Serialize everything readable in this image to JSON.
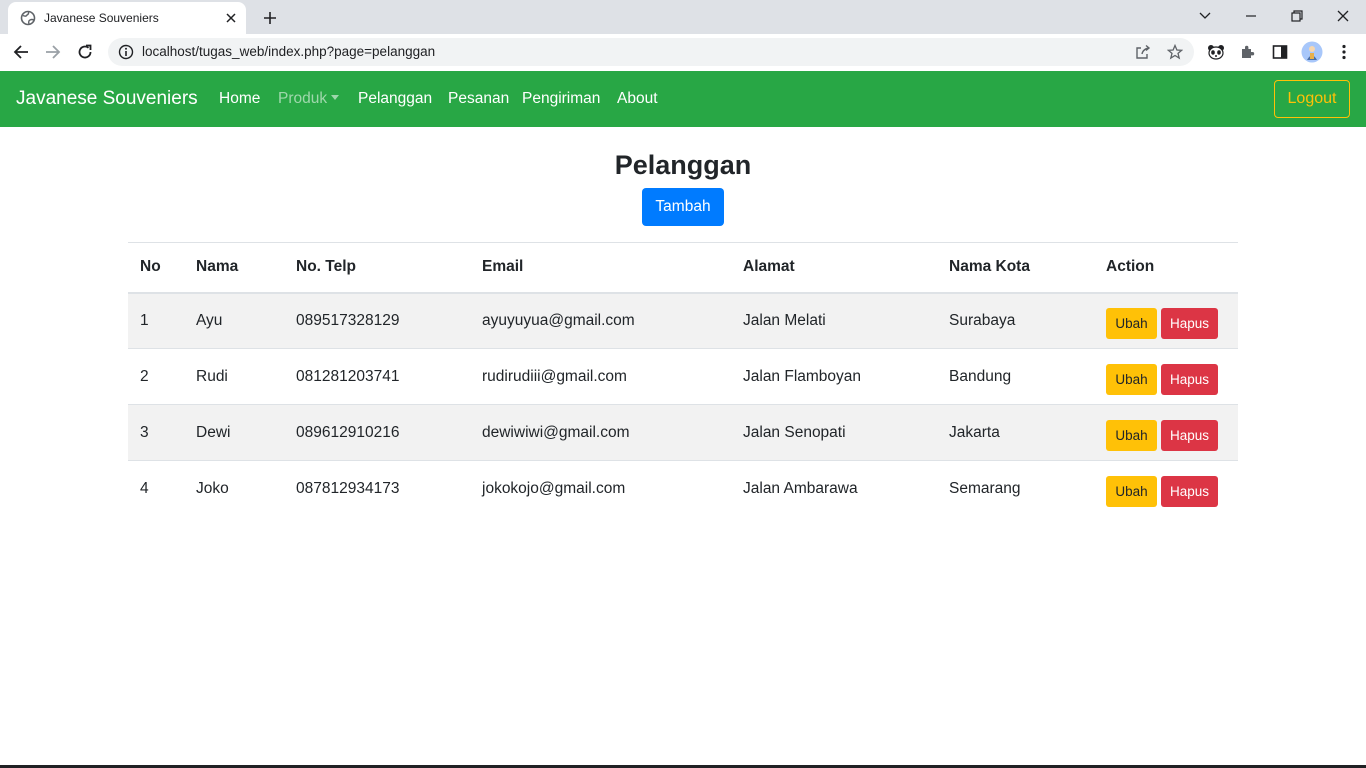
{
  "browser": {
    "tab_title": "Javanese Souveniers",
    "url": "localhost/tugas_web/index.php?page=pelanggan"
  },
  "navbar": {
    "brand": "Javanese Souveniers",
    "links": {
      "home": "Home",
      "produk": "Produk",
      "pelanggan": "Pelanggan",
      "pesanan": "Pesanan",
      "pengiriman": "Pengiriman",
      "about": "About"
    },
    "logout": "Logout",
    "colors": {
      "background": "#28a745",
      "logout_outline": "#ffc107"
    }
  },
  "page": {
    "title": "Pelanggan",
    "add_button": "Tambah"
  },
  "table": {
    "headers": [
      "No",
      "Nama",
      "No. Telp",
      "Email",
      "Alamat",
      "Nama Kota",
      "Action"
    ],
    "rows": [
      [
        "1",
        "Ayu",
        "089517328129",
        "ayuyuyua@gmail.com",
        "Jalan Melati",
        "Surabaya"
      ],
      [
        "2",
        "Rudi",
        "081281203741",
        "rudirudiii@gmail.com",
        "Jalan Flamboyan",
        "Bandung"
      ],
      [
        "3",
        "Dewi",
        "089612910216",
        "dewiwiwi@gmail.com",
        "Jalan Senopati",
        "Jakarta"
      ],
      [
        "4",
        "Joko",
        "087812934173",
        "jokokojo@gmail.com",
        "Jalan Ambarawa",
        "Semarang"
      ]
    ],
    "action_labels": {
      "edit": "Ubah",
      "delete": "Hapus"
    }
  }
}
